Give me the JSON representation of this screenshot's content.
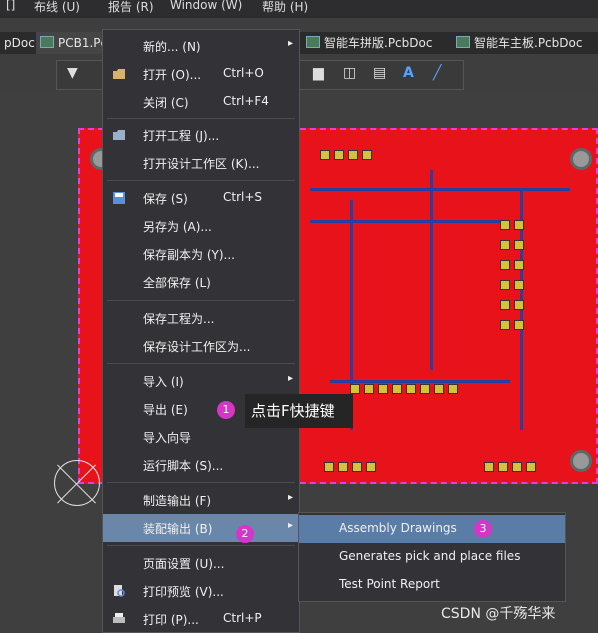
{
  "menubar": {
    "items": [
      "[]",
      "布线 (U)",
      "报告 (R)",
      "Window (W)",
      "帮助 (H)"
    ]
  },
  "tabs": [
    {
      "label": "pDoc",
      "active": false
    },
    {
      "label": "PCB1.Pc",
      "active": true
    },
    {
      "label": "智能车拼版.PcbDoc",
      "active": false
    },
    {
      "label": "智能车主板.PcbDoc",
      "active": false
    }
  ],
  "file_menu": {
    "items": [
      {
        "label": "新的... (N)",
        "shortcut": "",
        "arrow": "▸"
      },
      {
        "label": "打开 (O)...",
        "shortcut": "Ctrl+O"
      },
      {
        "label": "关闭 (C)",
        "shortcut": "Ctrl+F4"
      },
      {
        "label": "打开工程 (J)..."
      },
      {
        "label": "打开设计工作区 (K)..."
      },
      {
        "label": "保存 (S)",
        "shortcut": "Ctrl+S"
      },
      {
        "label": "另存为 (A)..."
      },
      {
        "label": "保存副本为 (Y)..."
      },
      {
        "label": "全部保存 (L)"
      },
      {
        "label": "保存工程为..."
      },
      {
        "label": "保存设计工作区为..."
      },
      {
        "label": "导入 (I)",
        "arrow": "▸"
      },
      {
        "label": "导出 (E)"
      },
      {
        "label": "导入向导"
      },
      {
        "label": "运行脚本 (S)..."
      },
      {
        "label": "制造输出 (F)",
        "arrow": "▸"
      },
      {
        "label": "装配输出 (B)",
        "arrow": "▸"
      },
      {
        "label": "页面设置 (U)..."
      },
      {
        "label": "打印预览 (V)..."
      },
      {
        "label": "打印 (P)...",
        "shortcut": "Ctrl+P"
      }
    ]
  },
  "annotations": {
    "badge1": "1",
    "badge2": "2",
    "badge3": "3",
    "tooltip": "点击F快捷键"
  },
  "submenu": {
    "items": [
      "Assembly Drawings",
      "Generates pick and place files",
      "Test Point Report"
    ]
  },
  "watermark": "CSDN @千殇华来",
  "colors": {
    "board": "#e8121a",
    "highlight": "#6a86a8",
    "badge": "#d436c8"
  }
}
